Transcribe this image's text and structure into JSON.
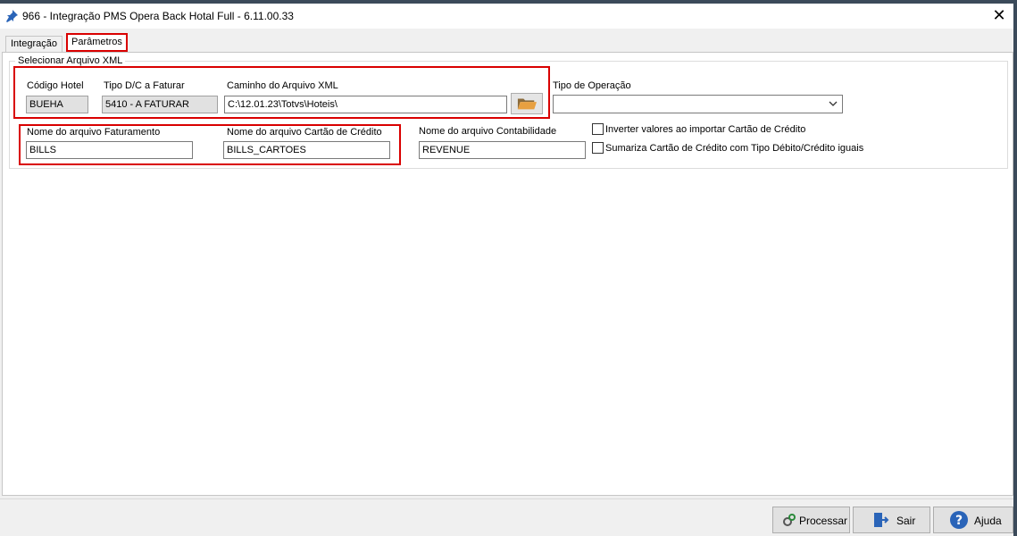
{
  "window": {
    "title": "966 - Integração PMS Opera Back Hotal Full - 6.11.00.33",
    "close_glyph": "✕"
  },
  "tabs": [
    {
      "label": "Integração",
      "active": false
    },
    {
      "label": "Parâmetros",
      "active": true
    }
  ],
  "group": {
    "legend": "Selecionar Arquivo XML"
  },
  "fields": {
    "codigo_hotel": {
      "label": "Código Hotel",
      "value": "BUEHA"
    },
    "tipo_dc": {
      "label": "Tipo D/C a Faturar",
      "value": "5410 -  A FATURAR"
    },
    "caminho_xml": {
      "label": "Caminho do Arquivo XML",
      "value": "C:\\12.01.23\\Totvs\\Hoteis\\"
    },
    "tipo_operacao": {
      "label": "Tipo de Operação",
      "value": ""
    },
    "arquivo_faturamento": {
      "label": "Nome do arquivo Faturamento",
      "value": "BILLS"
    },
    "arquivo_cartao": {
      "label": "Nome do arquivo Cartão de Crédito",
      "value": "BILLS_CARTOES"
    },
    "arquivo_contabilidade": {
      "label": "Nome do arquivo Contabilidade",
      "value": "REVENUE"
    }
  },
  "checkboxes": {
    "inverter": {
      "label": "Inverter valores ao importar Cartão de Crédito",
      "checked": false
    },
    "sumariza": {
      "label": "Sumariza Cartão de Crédito com Tipo Débito/Crédito iguais",
      "checked": false
    }
  },
  "buttons": {
    "processar": "Processar",
    "sair": "Sair",
    "ajuda": "Ajuda"
  },
  "icons": {
    "pin": "pin-icon",
    "folder": "folder-open-icon",
    "dropdown": "chevron-down-icon",
    "processar": "gears-icon",
    "sair": "exit-door-icon",
    "ajuda": "help-icon"
  },
  "colors": {
    "highlight_red": "#d90000",
    "help_blue": "#2a64b8",
    "folder_orange": "#e8a040"
  }
}
